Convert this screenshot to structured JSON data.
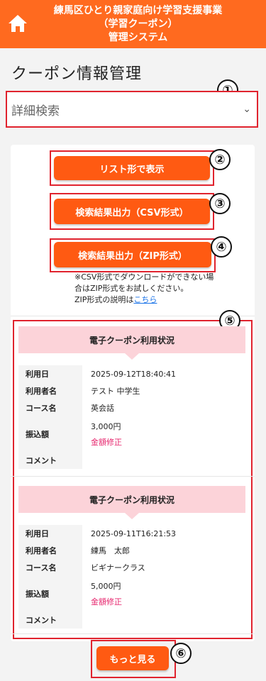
{
  "header": {
    "title": "練馬区ひとり親家庭向け学習支援事業\n（学習クーポン）\n管理システム"
  },
  "page": {
    "title": "クーポン情報管理"
  },
  "detail_search": {
    "label": "詳細検索"
  },
  "buttons": {
    "list_view": "リスト形で表示",
    "csv_export": "検索結果出力（CSV形式）",
    "zip_export": "検索結果出力（ZIP形式）",
    "more": "もっと見る"
  },
  "note": {
    "line1": "※CSV形式でダウンロードができない場",
    "line2": "合はZIP形式をお試しください。",
    "line3_prefix": "ZIP形式の説明は",
    "line3_link": "こちら"
  },
  "callouts": [
    "①",
    "②",
    "③",
    "④",
    "⑤",
    "⑥"
  ],
  "cards": [
    {
      "title": "電子クーポン利用状況",
      "labels": {
        "date": "利用日",
        "user": "利用者名",
        "course": "コース名",
        "amount": "振込額",
        "comment": "コメント"
      },
      "date": "2025-09-12T18:40:41",
      "user": "テスト 中学生",
      "course": "英会話",
      "amount": "3,000円",
      "amount_fix": "金額修正",
      "comment": ""
    },
    {
      "title": "電子クーポン利用状況",
      "labels": {
        "date": "利用日",
        "user": "利用者名",
        "course": "コース名",
        "amount": "振込額",
        "comment": "コメント"
      },
      "date": "2025-09-11T16:21:53",
      "user": "練馬　太郎",
      "course": "ビギナークラス",
      "amount": "5,000円",
      "amount_fix": "金額修正",
      "comment": ""
    }
  ],
  "colors": {
    "header": "#ff6a1f",
    "button": "#ff5a12",
    "frame": "#e0232e",
    "card_header": "#fcd3d9",
    "fix_link": "#e6246c"
  }
}
